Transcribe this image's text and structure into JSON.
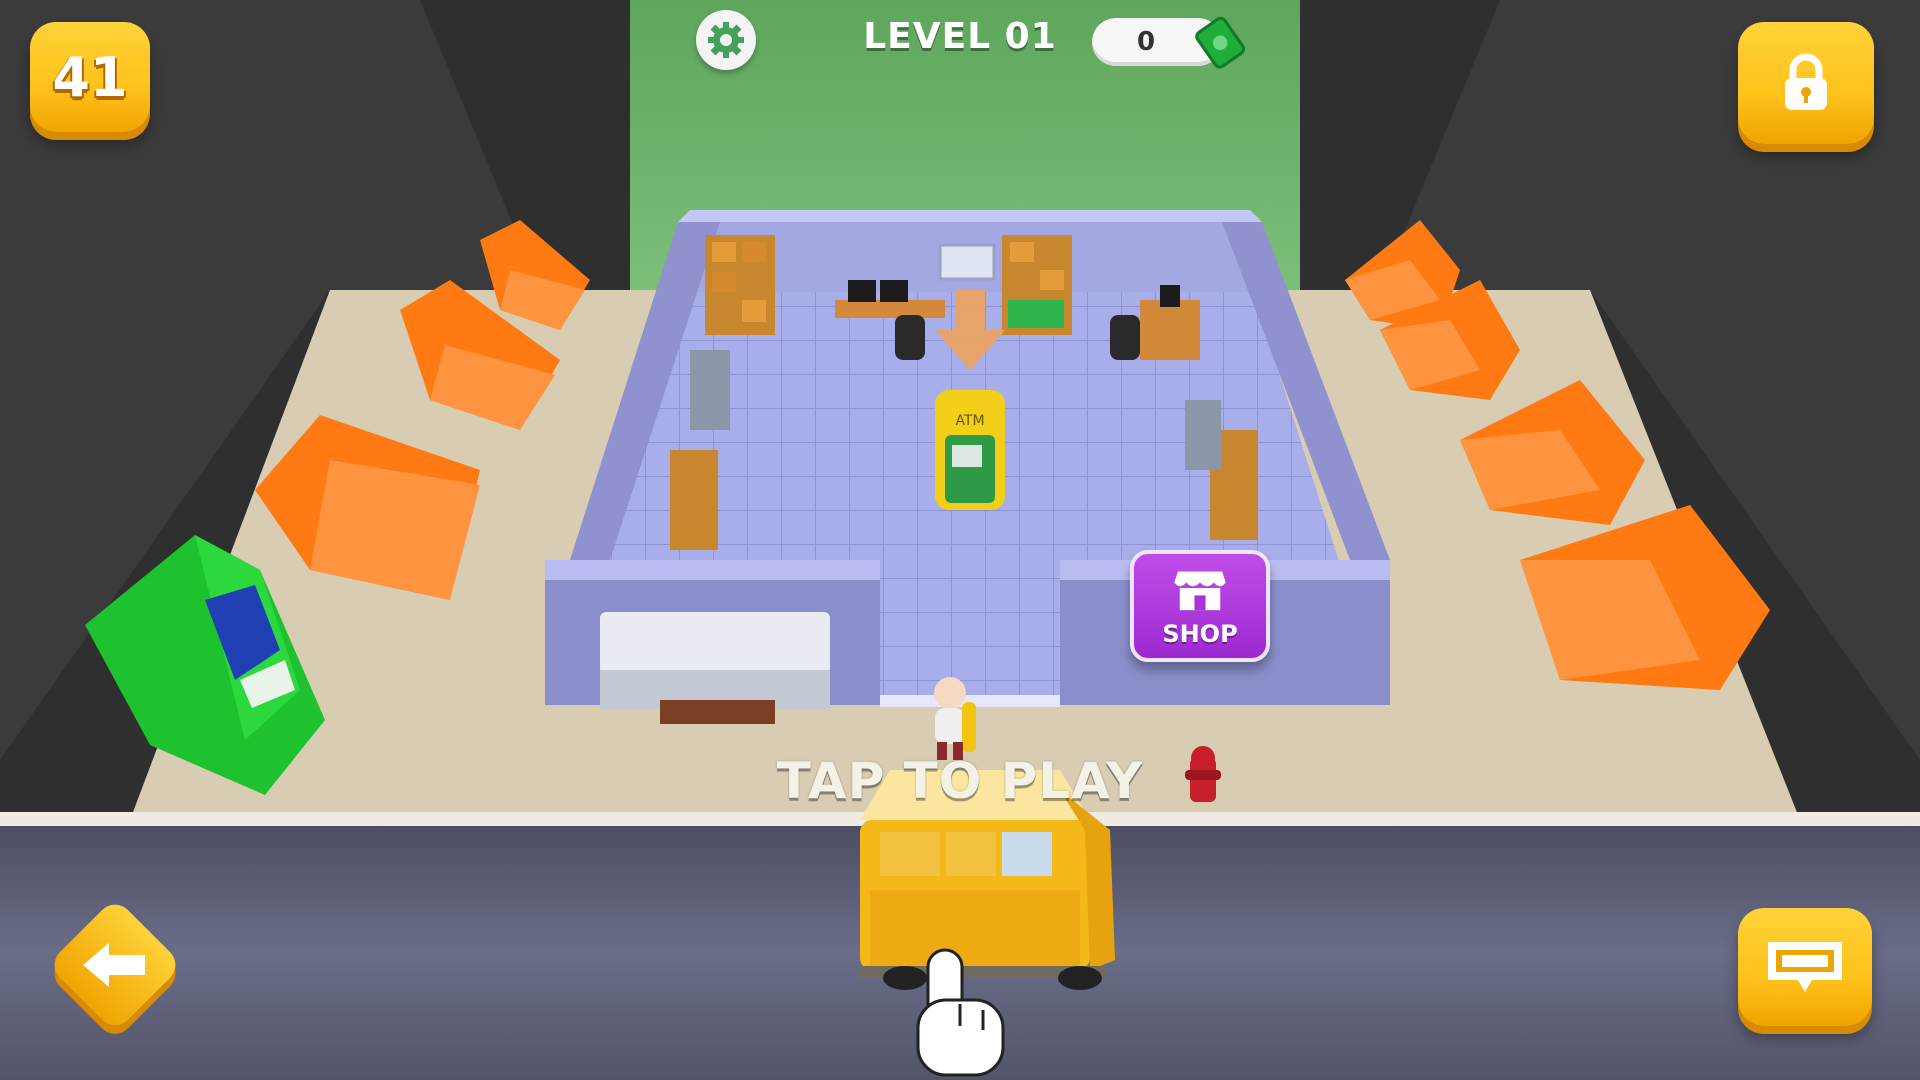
{
  "hud": {
    "level_count": "41",
    "level_title": "LEVEL 01",
    "money": "0",
    "icons": {
      "settings": "gear-icon",
      "money": "cash-icon",
      "lock": "lock-icon",
      "back": "arrow-left-icon",
      "atm": "atm-icon"
    }
  },
  "world": {
    "shop_label": "SHOP",
    "atm_sign": "ATM"
  },
  "prompt": {
    "tap_to_play": "TAP TO PLAY"
  },
  "colors": {
    "button_yellow": "#ffc21a",
    "shop_purple": "#a832d8",
    "wall_green": "#6fb36c",
    "floor_tiles": "#9ea6e4",
    "room_walls": "#8f92cf",
    "sofa_orange": "#ff7a12",
    "road": "#5c5f78"
  }
}
